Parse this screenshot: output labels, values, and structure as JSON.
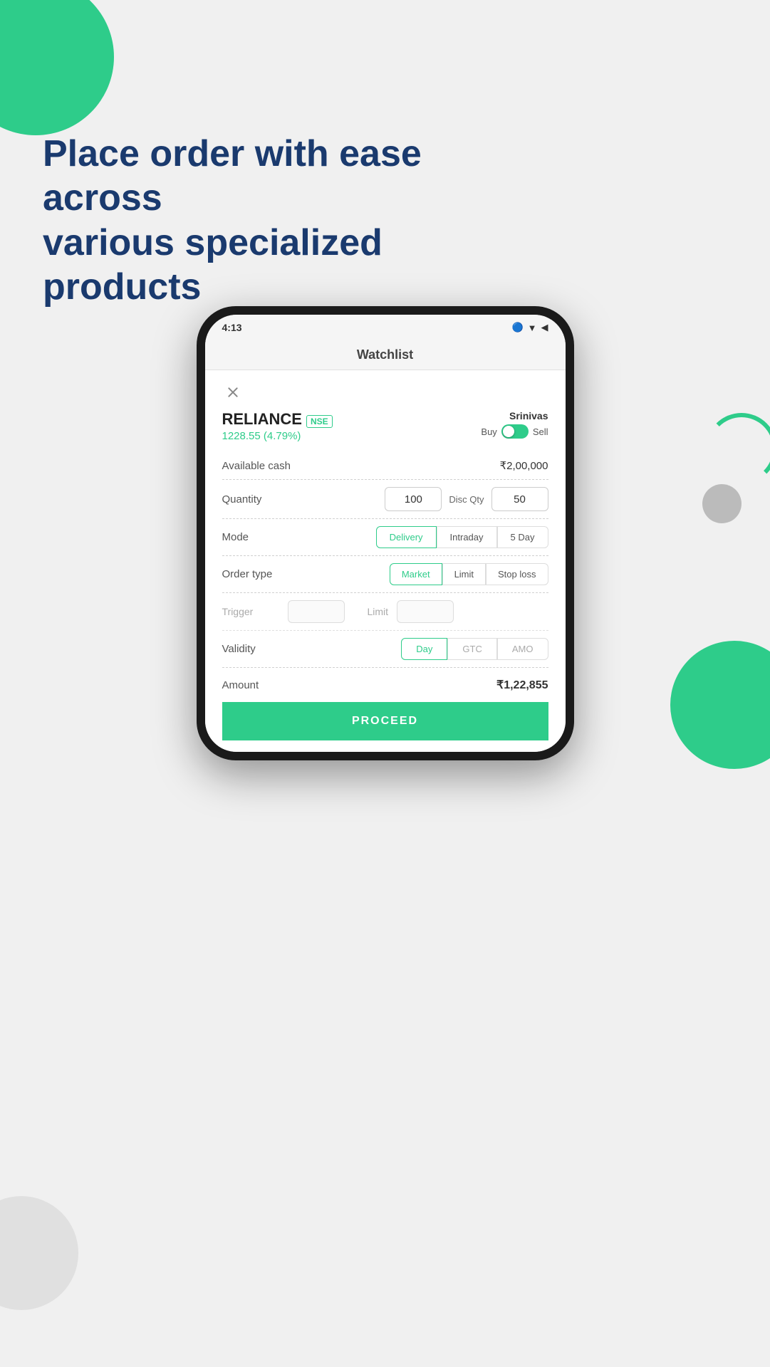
{
  "page": {
    "background": "#f0f0f0"
  },
  "headline": {
    "line1": "Place order with ease across",
    "line2": "various specialized products"
  },
  "status_bar": {
    "time": "4:13",
    "icons": "🔵 ▼ ◀"
  },
  "app_header": {
    "title": "Watchlist"
  },
  "order_form": {
    "close_label": "✕",
    "stock_name": "RELIANCE",
    "exchange": "NSE",
    "price_change": "1228.55 (4.79%)",
    "account_name": "Srinivas",
    "buy_label": "Buy",
    "sell_label": "Sell",
    "available_cash_label": "Available cash",
    "available_cash_value": "₹2,00,000",
    "quantity_label": "Quantity",
    "quantity_value": "100",
    "disc_qty_label": "Disc Qty",
    "disc_qty_value": "50",
    "mode_label": "Mode",
    "mode_options": [
      {
        "id": "delivery",
        "label": "Delivery",
        "active": true
      },
      {
        "id": "intraday",
        "label": "Intraday",
        "active": false
      },
      {
        "id": "5day",
        "label": "5 Day",
        "active": false
      }
    ],
    "order_type_label": "Order type",
    "order_type_options": [
      {
        "id": "market",
        "label": "Market",
        "active": true
      },
      {
        "id": "limit",
        "label": "Limit",
        "active": false
      },
      {
        "id": "stoploss",
        "label": "Stop loss",
        "active": false
      }
    ],
    "trigger_label": "Trigger",
    "trigger_value": "",
    "limit_label": "Limit",
    "limit_value": "",
    "validity_label": "Validity",
    "validity_options": [
      {
        "id": "day",
        "label": "Day",
        "active": true
      },
      {
        "id": "gtc",
        "label": "GTC",
        "active": false
      },
      {
        "id": "amo",
        "label": "AMO",
        "active": false
      }
    ],
    "amount_label": "Amount",
    "amount_value": "₹1,22,855",
    "proceed_label": "PROCEED"
  }
}
